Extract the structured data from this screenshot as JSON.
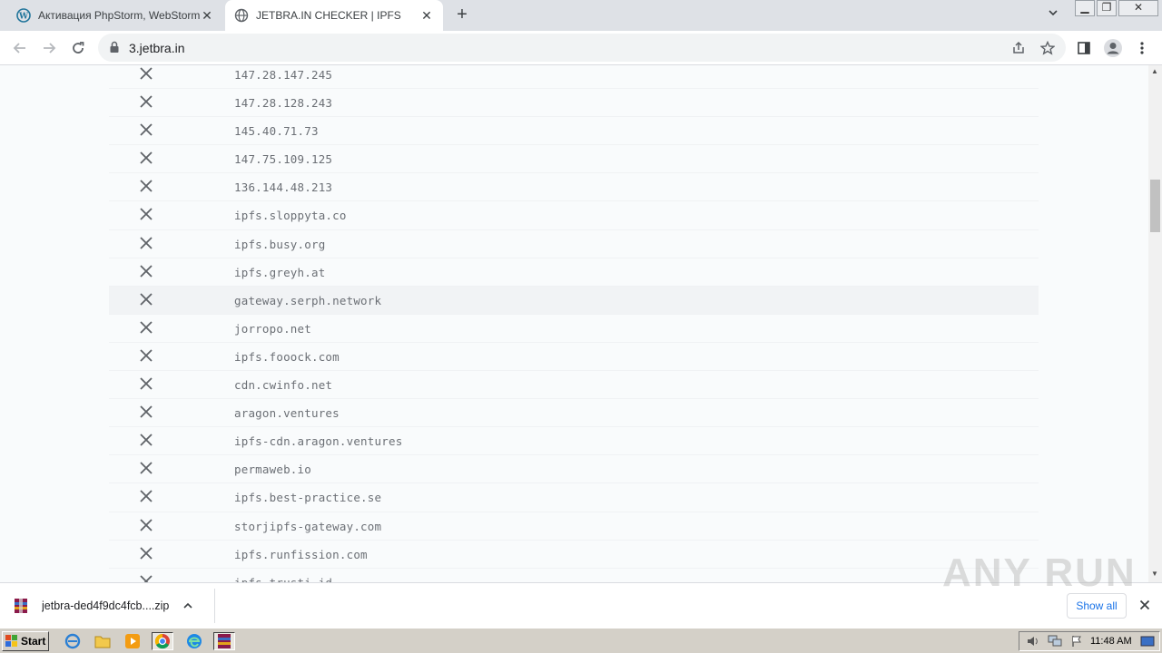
{
  "tabs": [
    {
      "title": "Активация PhpStorm, WebStorm, IntelliJ",
      "icon": "wordpress-icon",
      "active": false
    },
    {
      "title": "JETBRA.IN CHECKER | IPFS",
      "icon": "globe-icon",
      "active": true
    }
  ],
  "address_bar": {
    "url": "3.jetbra.in"
  },
  "gateways": [
    "147.28.147.245",
    "147.28.128.243",
    "145.40.71.73",
    "147.75.109.125",
    "136.144.48.213",
    "ipfs.sloppyta.co",
    "ipfs.busy.org",
    "ipfs.greyh.at",
    "gateway.serph.network",
    "jorropo.net",
    "ipfs.fooock.com",
    "cdn.cwinfo.net",
    "aragon.ventures",
    "ipfs-cdn.aragon.ventures",
    "permaweb.io",
    "ipfs.best-practice.se",
    "storjipfs-gateway.com",
    "ipfs.runfission.com",
    "ipfs.trusti.id"
  ],
  "status_icon": "x-icon",
  "download_bar": {
    "filename": "jetbra-ded4f9dc4fcb....zip",
    "show_all_label": "Show all",
    "watermark": "ANY RUN"
  },
  "taskbar": {
    "start_label": "Start",
    "clock": "11:48 AM"
  },
  "colors": {
    "tabstrip": "#dee1e6",
    "content_bg": "#f9fbfc",
    "link_blue": "#1a73e8",
    "hostname_gray": "#6b6f75"
  }
}
